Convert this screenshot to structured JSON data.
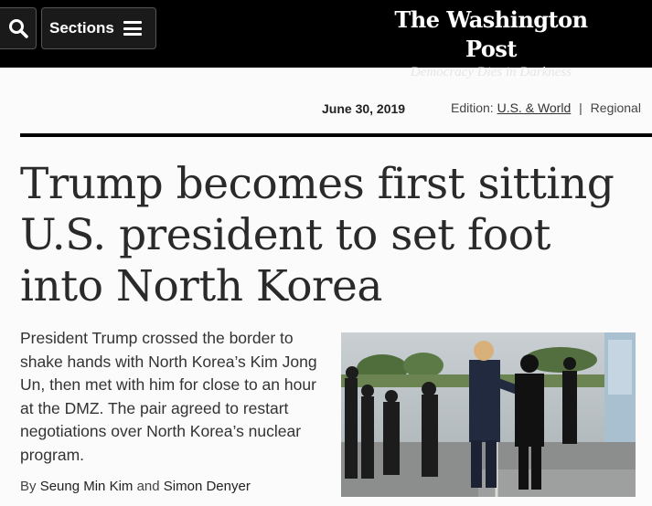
{
  "header": {
    "sections_label": "Sections",
    "logo_name": "The Washington Post",
    "tagline": "Democracy Dies in Darkness"
  },
  "dateline": {
    "date": "June 30, 2019",
    "edition_label": "Edition:",
    "edition_current": "U.S. & World",
    "separator": "|",
    "edition_other": "Regional"
  },
  "article": {
    "headline": "Trump becomes first sitting U.S. president to set foot into North Korea",
    "summary": "President Trump crossed the border to shake hands with North Korea’s Kim Jong Un, then met with him for close to an hour at the DMZ. The pair agreed to restart negotiations over North Korea’s nuclear program.",
    "byline_prefix": "By",
    "author_1": "Seung Min Kim",
    "byline_and": "and",
    "author_2": "Simon Denyer"
  },
  "colors": {
    "header_bg": "#000000",
    "page_bg": "#fbfbfb",
    "headline": "#2a2a2a"
  },
  "icons": [
    "search-icon",
    "hamburger-menu-icon"
  ]
}
